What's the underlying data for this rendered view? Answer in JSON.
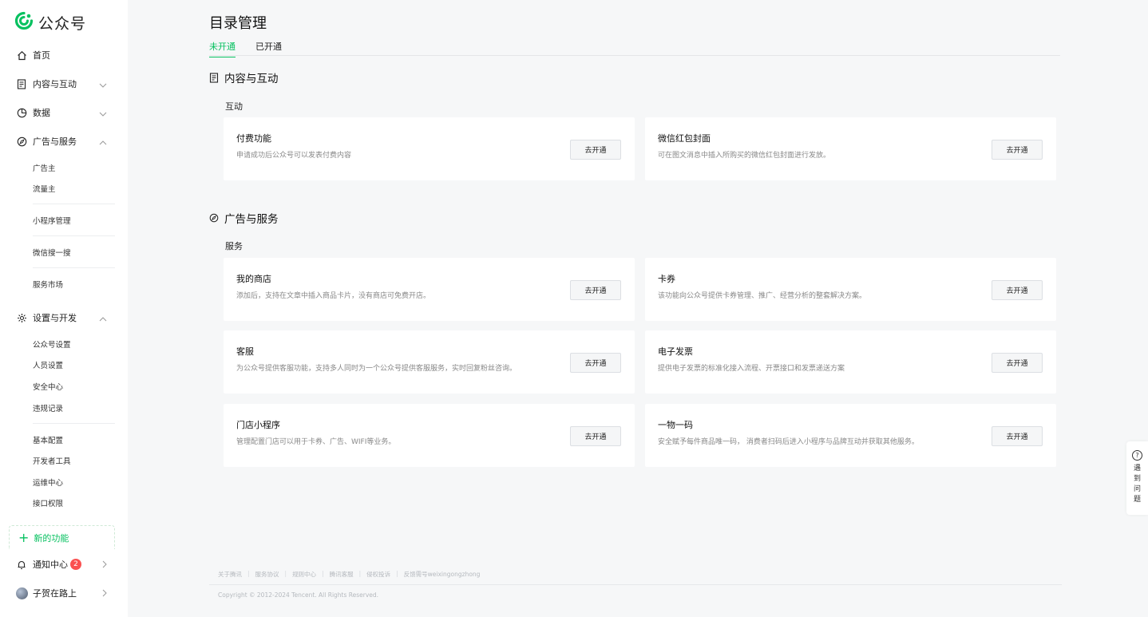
{
  "brand": {
    "name": "公众号",
    "accent": "#07c160"
  },
  "sidebar": {
    "home": "首页",
    "content": "内容与互动",
    "data": "数据",
    "ads": "广告与服务",
    "ads_sub": [
      "广告主",
      "流量主",
      "小程序管理",
      "微信搜一搜",
      "服务市场"
    ],
    "settings": "设置与开发",
    "settings_sub": [
      "公众号设置",
      "人员设置",
      "安全中心",
      "违规记录",
      "基本配置",
      "开发者工具",
      "运维中心",
      "接口权限"
    ],
    "new_feature": "新的功能",
    "notifications": "通知中心",
    "notifications_count": "2",
    "user_name": "子贺在路上"
  },
  "page": {
    "title": "目录管理",
    "tabs": [
      "未开通",
      "已开通"
    ],
    "active_tab": "未开通"
  },
  "sections": [
    {
      "title": "内容与互动",
      "groups": [
        {
          "label": "互动",
          "cards": [
            {
              "name": "付费功能",
              "desc": "申请成功后公众号可以发表付费内容",
              "action": "去开通"
            },
            {
              "name": "微信红包封面",
              "desc": "可在图文消息中插入所购买的微信红包封面进行发放。",
              "action": "去开通"
            }
          ]
        }
      ]
    },
    {
      "title": "广告与服务",
      "groups": [
        {
          "label": "服务",
          "cards": [
            {
              "name": "我的商店",
              "desc": "添加后，支持在文章中插入商品卡片，没有商店可免费开店。",
              "action": "去开通"
            },
            {
              "name": "卡券",
              "desc": "该功能向公众号提供卡券管理、推广、经营分析的整套解决方案。",
              "action": "去开通"
            },
            {
              "name": "客服",
              "desc": "为公众号提供客服功能，支持多人同时为一个公众号提供客服服务，实时回复粉丝咨询。",
              "action": "去开通"
            },
            {
              "name": "电子发票",
              "desc": "提供电子发票的标准化接入流程、开票接口和发票递送方案",
              "action": "去开通"
            },
            {
              "name": "门店小程序",
              "desc": "管理配置门店可以用于卡券、广告、WIFI等业务。",
              "action": "去开通"
            },
            {
              "name": "一物一码",
              "desc": "安全赋予每件商品唯一码， 消费者扫码后进入小程序与品牌互动并获取其他服务。",
              "action": "去开通"
            }
          ]
        }
      ]
    }
  ],
  "footer": {
    "links": [
      "关于腾讯",
      "服务协议",
      "规则中心",
      "腾讯客服",
      "侵权投诉",
      "反馈需号weixingongzhong"
    ],
    "copyright": "Copyright © 2012-2024 Tencent. All Rights Reserved."
  },
  "help": {
    "label": "遇到问题"
  }
}
